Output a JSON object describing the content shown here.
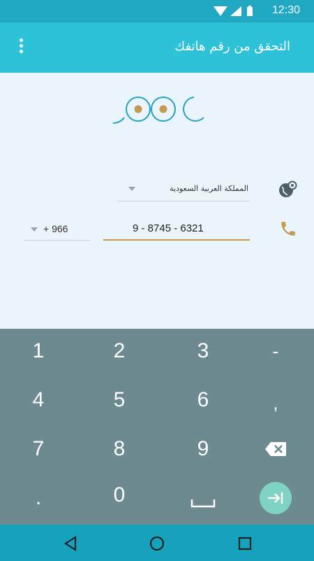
{
  "status_bar": {
    "time": "12:30",
    "icons": [
      "wifi-icon",
      "signal-icon",
      "battery-icon"
    ]
  },
  "app_bar": {
    "title": "التحقق من رقم هاتفك",
    "menu_icon": "more-vert-icon"
  },
  "form": {
    "country": {
      "label": "المملكة العربية السعودية"
    },
    "country_code": {
      "label": "+ 966"
    },
    "phone": {
      "value": "9 - 8745 - 6321"
    }
  },
  "keyboard": {
    "keys": [
      "1",
      "2",
      "3",
      "-",
      "4",
      "5",
      "6",
      ",",
      "7",
      "8",
      "9",
      "backspace",
      ".",
      "0",
      "space",
      "enter"
    ],
    "labels": {
      "k1": "1",
      "k2": "2",
      "k3": "3",
      "kdash": "-",
      "k4": "4",
      "k5": "5",
      "k6": "6",
      "kcomma": ",",
      "k7": "7",
      "k8": "8",
      "k9": "9",
      "kdot": ".",
      "k0": "0"
    }
  },
  "nav_bar": {
    "items": [
      "back-icon",
      "home-icon",
      "recents-icon"
    ]
  },
  "colors": {
    "status": "#21a9c3",
    "appbar": "#2dc2d8",
    "background": "#e9f4fb",
    "accent": "#c39a50",
    "keyboard": "#6d8a91",
    "enter": "#7ed3c3",
    "nav": "#16a2bd"
  }
}
